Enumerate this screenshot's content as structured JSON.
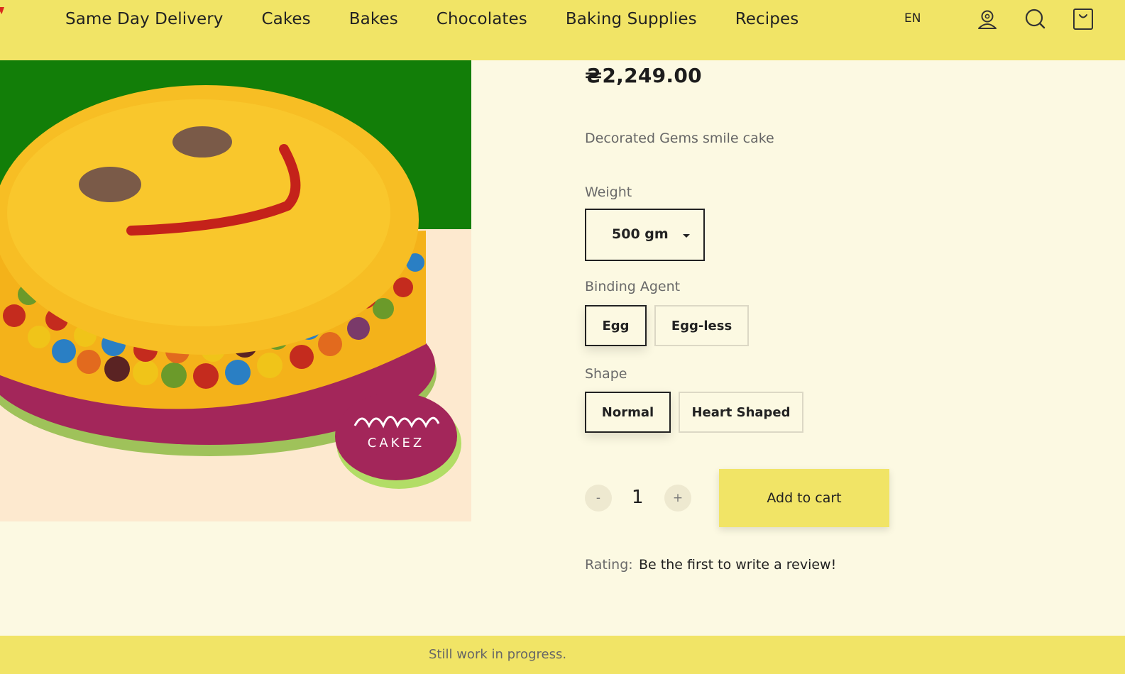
{
  "nav": {
    "items": [
      {
        "label": "Same Day Delivery"
      },
      {
        "label": "Cakes"
      },
      {
        "label": "Bakes"
      },
      {
        "label": "Chocolates"
      },
      {
        "label": "Baking Supplies"
      },
      {
        "label": "Recipes"
      }
    ],
    "language": "EN",
    "icons": [
      "account-icon",
      "search-icon",
      "cart-bag-icon"
    ]
  },
  "product": {
    "price": "₴2,249.00",
    "description": "Decorated Gems smile cake",
    "image_alt": "smile-cake-image",
    "image_logo_text": "CAKEZ",
    "weight": {
      "label": "Weight",
      "selected": "500 gm"
    },
    "binding_agent": {
      "label": "Binding Agent",
      "options": [
        "Egg",
        "Egg-less"
      ],
      "selected": "Egg"
    },
    "shape": {
      "label": "Shape",
      "options": [
        "Normal",
        "Heart Shaped"
      ],
      "selected": "Normal"
    },
    "quantity": {
      "decrement": "-",
      "value": "1",
      "increment": "+"
    },
    "add_to_cart": "Add to cart",
    "rating": {
      "label": "Rating:",
      "value": "Be the first to write a review!"
    }
  },
  "footer": {
    "text": "Still work in progress."
  },
  "colors": {
    "header_bg": "#f1e466",
    "page_bg": "#fcf9e2",
    "accent": "#f1e466"
  }
}
